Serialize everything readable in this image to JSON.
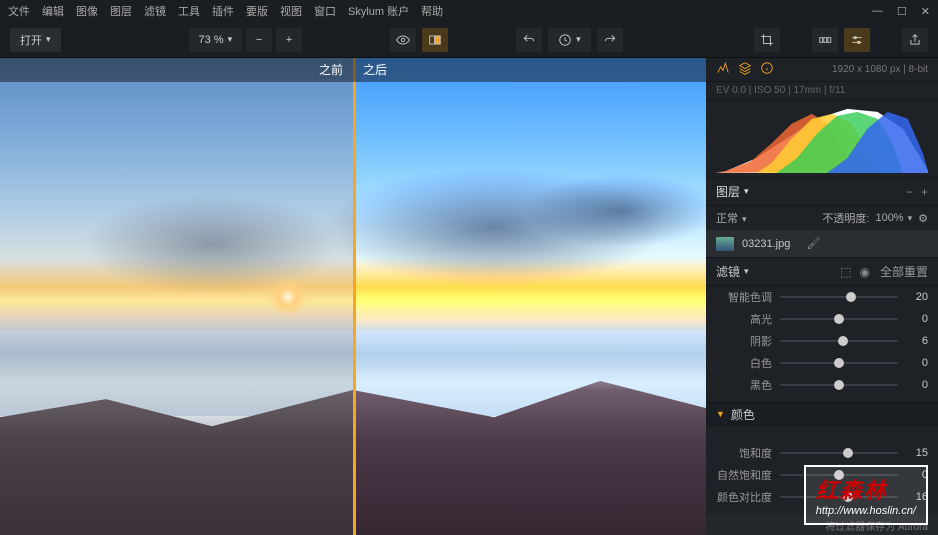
{
  "menu": [
    "文件",
    "编辑",
    "图像",
    "图层",
    "滤镜",
    "工具",
    "插件",
    "要版",
    "视图",
    "窗口",
    "Skylum 账户",
    "帮助"
  ],
  "toolbar": {
    "open": "打开",
    "zoom": "73 %"
  },
  "compare": {
    "before": "之前",
    "after": "之后"
  },
  "info": {
    "dimensions": "1920 x 1080 px",
    "depth": "8-bit",
    "exif": "EV 0.0 | ISO 50 | 17mm | f/11"
  },
  "panels": {
    "layers": {
      "title": "图层",
      "mode": "正常",
      "opacity_label": "不透明度:",
      "opacity": "100%",
      "file": "03231.jpg"
    },
    "filters": {
      "title": "滤镜",
      "reset": "全部重置"
    },
    "color_group": "颜色"
  },
  "sliders1": [
    {
      "label": "智能色调",
      "val": 20,
      "pos": 60
    },
    {
      "label": "高光",
      "val": 0,
      "pos": 50
    },
    {
      "label": "阴影",
      "val": 6,
      "pos": 53
    },
    {
      "label": "白色",
      "val": 0,
      "pos": 50
    },
    {
      "label": "黑色",
      "val": 0,
      "pos": 50
    }
  ],
  "sliders2": [
    {
      "label": "饱和度",
      "val": 15,
      "pos": 58
    },
    {
      "label": "自然饱和度",
      "val": 0,
      "pos": 50
    },
    {
      "label": "颜色对比度",
      "val": 16,
      "pos": 58
    }
  ],
  "footer": "将过滤器保存为 Aurora",
  "watermark": {
    "t1": "红森林",
    "t2": "http://www.hoslin.cn/"
  }
}
